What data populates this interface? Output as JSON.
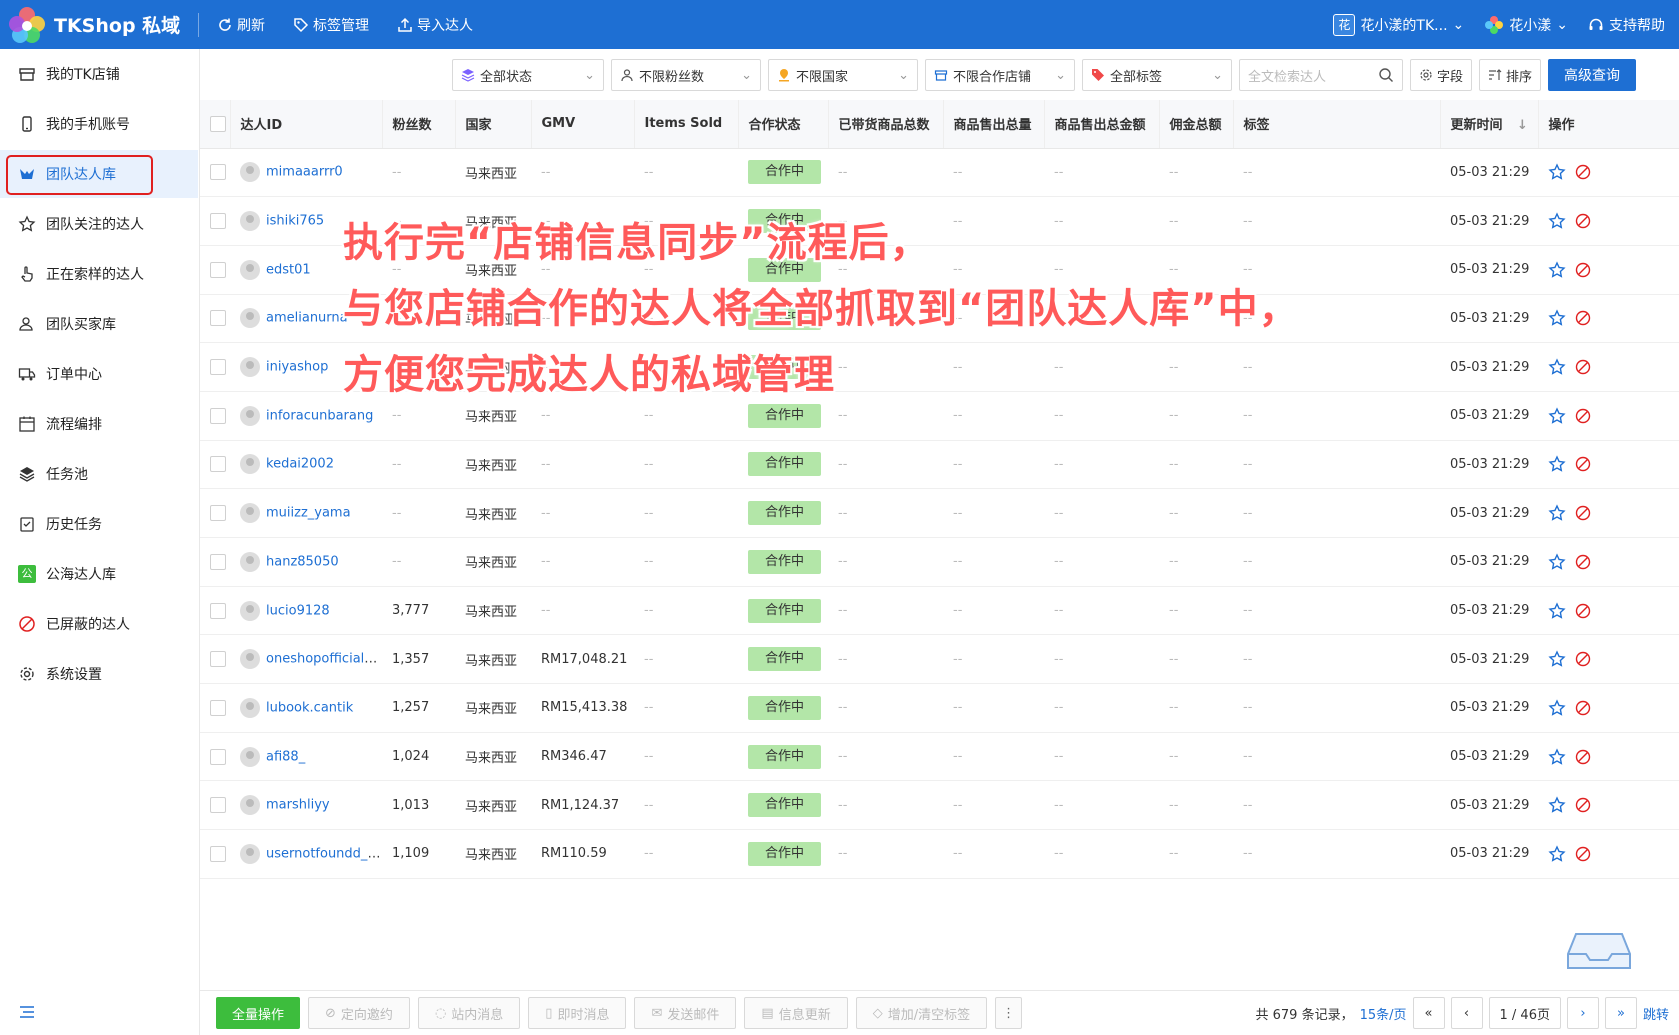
{
  "header": {
    "brand": "TKShop 私域",
    "nav": [
      {
        "label": "刷新",
        "icon": "refresh-icon"
      },
      {
        "label": "标签管理",
        "icon": "tag-icon"
      },
      {
        "label": "导入达人",
        "icon": "upload-icon"
      }
    ],
    "team_badge": "花",
    "team_name": "花小漾的TK...",
    "user_name": "花小漾",
    "help": "支持帮助"
  },
  "sidebar": {
    "items": [
      {
        "label": "我的TK店铺",
        "icon": "shop-icon"
      },
      {
        "label": "我的手机账号",
        "icon": "phone-icon"
      },
      {
        "label": "团队达人库",
        "icon": "team-creators-icon",
        "active": true
      },
      {
        "label": "团队关注的达人",
        "icon": "star-icon"
      },
      {
        "label": "正在索样的达人",
        "icon": "hand-icon"
      },
      {
        "label": "团队买家库",
        "icon": "buyers-icon"
      },
      {
        "label": "订单中心",
        "icon": "truck-icon"
      },
      {
        "label": "流程编排",
        "icon": "calendar-icon"
      },
      {
        "label": "任务池",
        "icon": "layers-icon"
      },
      {
        "label": "历史任务",
        "icon": "clipboard-icon"
      },
      {
        "label": "公海达人库",
        "icon": "public-pool-icon",
        "badge": "公"
      },
      {
        "label": "已屏蔽的达人",
        "icon": "block-icon"
      },
      {
        "label": "系统设置",
        "icon": "gear-icon"
      }
    ]
  },
  "filters": {
    "status": "全部状态",
    "fans": "不限粉丝数",
    "country": "不限国家",
    "shop": "不限合作店铺",
    "tags": "全部标签",
    "search_placeholder": "全文检索达人",
    "fields": "字段",
    "sort": "排序",
    "advanced": "高级查询"
  },
  "table": {
    "columns": [
      "达人ID",
      "粉丝数",
      "国家",
      "GMV",
      "Items Sold",
      "合作状态",
      "已带货商品总数",
      "商品售出总量",
      "商品售出总金额",
      "佣金总额",
      "标签",
      "更新时间",
      "操作"
    ],
    "rows": [
      {
        "id": "mimaaarrr0",
        "fans": "--",
        "country": "马来西亚",
        "gmv": "--",
        "items": "--",
        "status": "合作中",
        "goods": "--",
        "sold": "--",
        "amount": "--",
        "commission": "--",
        "tags": "--",
        "updated": "05-03 21:29"
      },
      {
        "id": "ishiki765",
        "fans": "--",
        "country": "马来西亚",
        "gmv": "--",
        "items": "--",
        "status": "合作中",
        "goods": "--",
        "sold": "--",
        "amount": "--",
        "commission": "--",
        "tags": "--",
        "updated": "05-03 21:29"
      },
      {
        "id": "edst01",
        "fans": "--",
        "country": "马来西亚",
        "gmv": "--",
        "items": "--",
        "status": "合作中",
        "goods": "--",
        "sold": "--",
        "amount": "--",
        "commission": "--",
        "tags": "--",
        "updated": "05-03 21:29"
      },
      {
        "id": "amelianurna",
        "fans": "--",
        "country": "马来西亚",
        "gmv": "--",
        "items": "--",
        "status": "合作中",
        "goods": "--",
        "sold": "--",
        "amount": "--",
        "commission": "--",
        "tags": "--",
        "updated": "05-03 21:29"
      },
      {
        "id": "iniyashop",
        "fans": "--",
        "country": "马来西亚",
        "gmv": "--",
        "items": "--",
        "status": "合作中",
        "goods": "--",
        "sold": "--",
        "amount": "--",
        "commission": "--",
        "tags": "--",
        "updated": "05-03 21:29"
      },
      {
        "id": "inforacunbarang",
        "fans": "--",
        "country": "马来西亚",
        "gmv": "--",
        "items": "--",
        "status": "合作中",
        "goods": "--",
        "sold": "--",
        "amount": "--",
        "commission": "--",
        "tags": "--",
        "updated": "05-03 21:29"
      },
      {
        "id": "kedai2002",
        "fans": "--",
        "country": "马来西亚",
        "gmv": "--",
        "items": "--",
        "status": "合作中",
        "goods": "--",
        "sold": "--",
        "amount": "--",
        "commission": "--",
        "tags": "--",
        "updated": "05-03 21:29"
      },
      {
        "id": "muiizz_yama",
        "fans": "--",
        "country": "马来西亚",
        "gmv": "--",
        "items": "--",
        "status": "合作中",
        "goods": "--",
        "sold": "--",
        "amount": "--",
        "commission": "--",
        "tags": "--",
        "updated": "05-03 21:29"
      },
      {
        "id": "hanz85050",
        "fans": "--",
        "country": "马来西亚",
        "gmv": "--",
        "items": "--",
        "status": "合作中",
        "goods": "--",
        "sold": "--",
        "amount": "--",
        "commission": "--",
        "tags": "--",
        "updated": "05-03 21:29"
      },
      {
        "id": "lucio9128",
        "fans": "3,777",
        "country": "马来西亚",
        "gmv": "--",
        "items": "--",
        "status": "合作中",
        "goods": "--",
        "sold": "--",
        "amount": "--",
        "commission": "--",
        "tags": "--",
        "updated": "05-03 21:29"
      },
      {
        "id": "oneshopofficialst...",
        "fans": "1,357",
        "country": "马来西亚",
        "gmv": "RM17,048.21",
        "items": "--",
        "status": "合作中",
        "goods": "--",
        "sold": "--",
        "amount": "--",
        "commission": "--",
        "tags": "--",
        "updated": "05-03 21:29"
      },
      {
        "id": "lubook.cantik",
        "fans": "1,257",
        "country": "马来西亚",
        "gmv": "RM15,413.38",
        "items": "--",
        "status": "合作中",
        "goods": "--",
        "sold": "--",
        "amount": "--",
        "commission": "--",
        "tags": "--",
        "updated": "05-03 21:29"
      },
      {
        "id": "afi88_",
        "fans": "1,024",
        "country": "马来西亚",
        "gmv": "RM346.47",
        "items": "--",
        "status": "合作中",
        "goods": "--",
        "sold": "--",
        "amount": "--",
        "commission": "--",
        "tags": "--",
        "updated": "05-03 21:29"
      },
      {
        "id": "marshliyy",
        "fans": "1,013",
        "country": "马来西亚",
        "gmv": "RM1,124.37",
        "items": "--",
        "status": "合作中",
        "goods": "--",
        "sold": "--",
        "amount": "--",
        "commission": "--",
        "tags": "--",
        "updated": "05-03 21:29"
      },
      {
        "id": "usernotfoundd_0...",
        "fans": "1,109",
        "country": "马来西亚",
        "gmv": "RM110.59",
        "items": "--",
        "status": "合作中",
        "goods": "--",
        "sold": "--",
        "amount": "--",
        "commission": "--",
        "tags": "--",
        "updated": "05-03 21:29"
      }
    ]
  },
  "overlay": {
    "line1": "执行完“店铺信息同步”流程后，",
    "line2": "与您店铺合作的达人将全部抓取到“团队达人库”中，",
    "line3": "方便您完成达人的私域管理"
  },
  "bottom": {
    "actions": [
      {
        "label": "全量操作",
        "icon": ""
      },
      {
        "label": "定向邀约",
        "icon": "tag-icon"
      },
      {
        "label": "站内消息",
        "icon": "chat-icon"
      },
      {
        "label": "即时消息",
        "icon": "phone-icon"
      },
      {
        "label": "发送邮件",
        "icon": "mail-icon"
      },
      {
        "label": "信息更新",
        "icon": "doc-icon"
      },
      {
        "label": "增加/清空标签",
        "icon": "tag-icon"
      }
    ],
    "total": "共 679 条记录，",
    "page_size": "15条/页",
    "page": "1 / 46页",
    "jump": "跳转"
  },
  "colors": {
    "primary": "#1e6fd3",
    "status_tag": "#b3e6a8",
    "green_button": "#3dbd3d",
    "annotation": "#ff5a5a",
    "highlight_box": "#e02020"
  }
}
